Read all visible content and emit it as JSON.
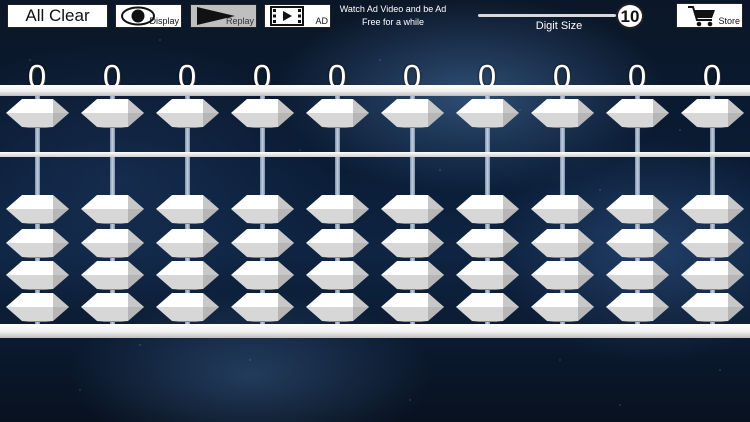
{
  "toolbar": {
    "all_clear_label": "All Clear",
    "display_label": "Display",
    "replay_label": "Replay",
    "ad_label": "AD",
    "ad_note_line1": "Watch Ad Video and be Ad",
    "ad_note_line2": "Free for a while",
    "store_label": "Store"
  },
  "digit_slider": {
    "value": "10",
    "label": "Digit Size"
  },
  "abacus": {
    "rod_count": 10,
    "digits": [
      "0",
      "0",
      "0",
      "0",
      "0",
      "0",
      "0",
      "0",
      "0",
      "0"
    ],
    "heaven_beads_per_rod": 1,
    "earth_beads_per_rod": 4
  },
  "icons": {
    "display": "eye-icon",
    "replay": "play-icon",
    "ad": "film-strip-icon",
    "store": "shopping-cart-icon"
  },
  "colors": {
    "bead_light": "#ffffff",
    "bead_shadow": "#9a9a9a",
    "frame": "#f2f2f2",
    "background": "#0a1b33"
  }
}
